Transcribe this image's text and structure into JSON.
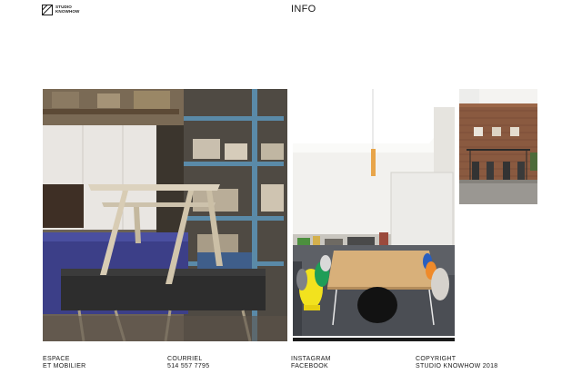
{
  "header": {
    "logo_line1": "STUDIO",
    "logo_line2": "KNOWHOW",
    "nav_info": "INFO"
  },
  "gallery": [
    {
      "subject": "workshop-table"
    },
    {
      "subject": "dining-room"
    },
    {
      "subject": "brick-wall-room"
    }
  ],
  "footer": {
    "col1": {
      "line1": "ESPACE",
      "line2": "ET MOBILIER"
    },
    "col2": {
      "line1": "COURRIEL",
      "line2": "514 557 7795"
    },
    "col3": {
      "line1": "INSTAGRAM",
      "line2": "FACEBOOK"
    },
    "col4": {
      "line1": "COPYRIGHT",
      "line2": "STUDIO KNOWHOW 2018"
    }
  }
}
